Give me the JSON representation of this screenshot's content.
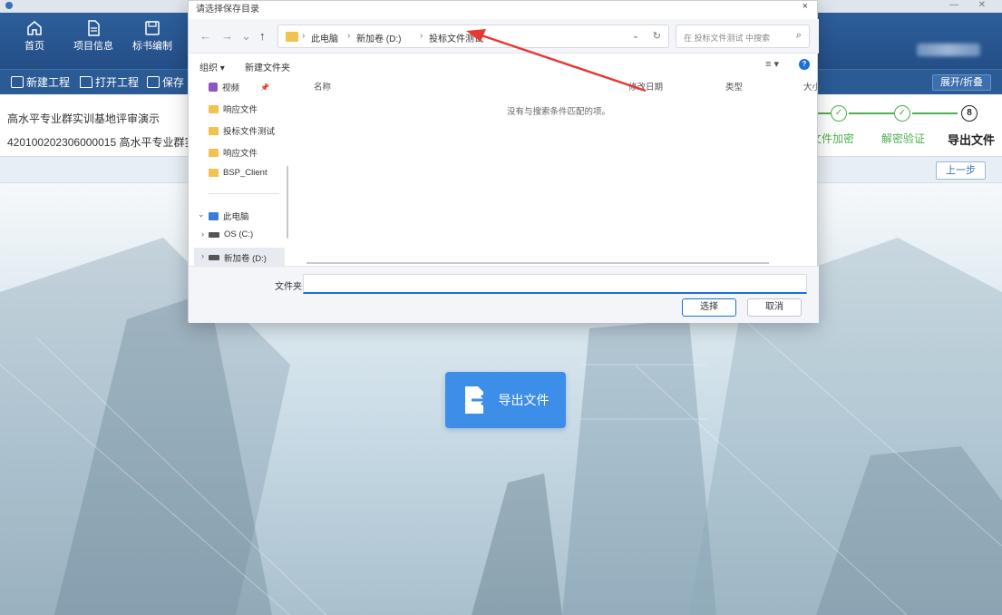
{
  "app": {
    "title_blurred": "",
    "nav": [
      {
        "label": "首页",
        "icon": "home-icon"
      },
      {
        "label": "项目信息",
        "icon": "document-icon"
      },
      {
        "label": "标书编制",
        "icon": "save-icon"
      }
    ],
    "toolbar": {
      "new_project": "新建工程",
      "open_project": "打开工程",
      "save_project": "保存",
      "expand_label": "展开/折叠"
    },
    "project": {
      "name": "高水平专业群实训基地评审演示",
      "code": "420100202306000015 高水平专业群实训"
    },
    "steps": [
      {
        "label": "文件加密",
        "state": "done"
      },
      {
        "label": "解密验证",
        "state": "done"
      },
      {
        "label": "导出文件",
        "state": "active",
        "number": "8"
      }
    ],
    "prev_step": "上一步",
    "export_button": "导出文件"
  },
  "dialog": {
    "title": "请选择保存目录",
    "close": "×",
    "nav": {
      "back": "←",
      "forward": "→",
      "history": "⌄",
      "up": "↑"
    },
    "breadcrumb": [
      "此电脑",
      "新加卷 (D:)",
      "投标文件测试"
    ],
    "search_placeholder": "在 投标文件测试 中搜索",
    "commands": {
      "organize": "组织 ▾",
      "new_folder": "新建文件夹"
    },
    "nav_pane": [
      {
        "label": "视频",
        "icon": "video-icon",
        "pinned": true
      },
      {
        "label": "响应文件",
        "icon": "folder-icon"
      },
      {
        "label": "投标文件测试",
        "icon": "folder-icon"
      },
      {
        "label": "响应文件",
        "icon": "folder-icon"
      },
      {
        "label": "BSP_Client",
        "icon": "folder-icon"
      },
      {
        "label": "此电脑",
        "icon": "pc-icon"
      },
      {
        "label": "OS (C:)",
        "icon": "drive-icon"
      },
      {
        "label": "新加卷 (D:)",
        "icon": "drive-icon"
      }
    ],
    "columns": [
      "名称",
      "修改日期",
      "类型",
      "大小"
    ],
    "empty_message": "没有与搜索条件匹配的项。",
    "folder_label": "文件夹:",
    "folder_value": "",
    "select_button": "选择",
    "cancel_button": "取消"
  },
  "colors": {
    "nav_bg": "#2d5f9c",
    "accent_blue": "#3d8ee8",
    "step_green": "#4caf50",
    "annotation_red": "#e53935"
  }
}
